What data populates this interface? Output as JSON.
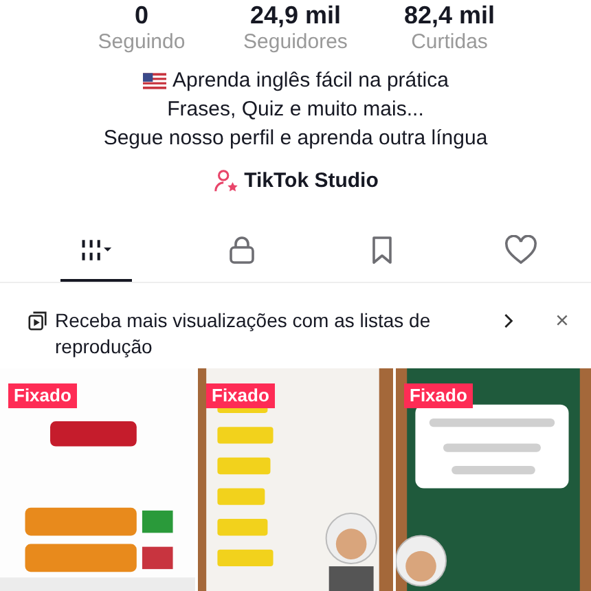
{
  "stats": [
    {
      "value": "0",
      "label": "Seguindo"
    },
    {
      "value": "24,9 mil",
      "label": "Seguidores"
    },
    {
      "value": "82,4 mil",
      "label": "Curtidas"
    }
  ],
  "bio": [
    {
      "text": "Aprenda inglês fácil na prática"
    },
    {
      "text": "Frases, Quiz e muito mais..."
    },
    {
      "text": "Segue nosso perfil e aprenda outra língua"
    }
  ],
  "studio": {
    "label": "TikTok Studio"
  },
  "tabs": [
    {
      "kind": "videos",
      "selected": true
    },
    {
      "kind": "private",
      "selected": false
    },
    {
      "kind": "saved",
      "selected": false
    },
    {
      "kind": "liked",
      "selected": false
    }
  ],
  "banner": {
    "text": "Receba mais visualizações com as listas de reprodução"
  },
  "videos": [
    {
      "kind": "picture",
      "badge": "Fixado"
    },
    {
      "kind": "picture",
      "badge": "Fixado"
    },
    {
      "kind": "picture",
      "badge": "Fixado"
    }
  ]
}
